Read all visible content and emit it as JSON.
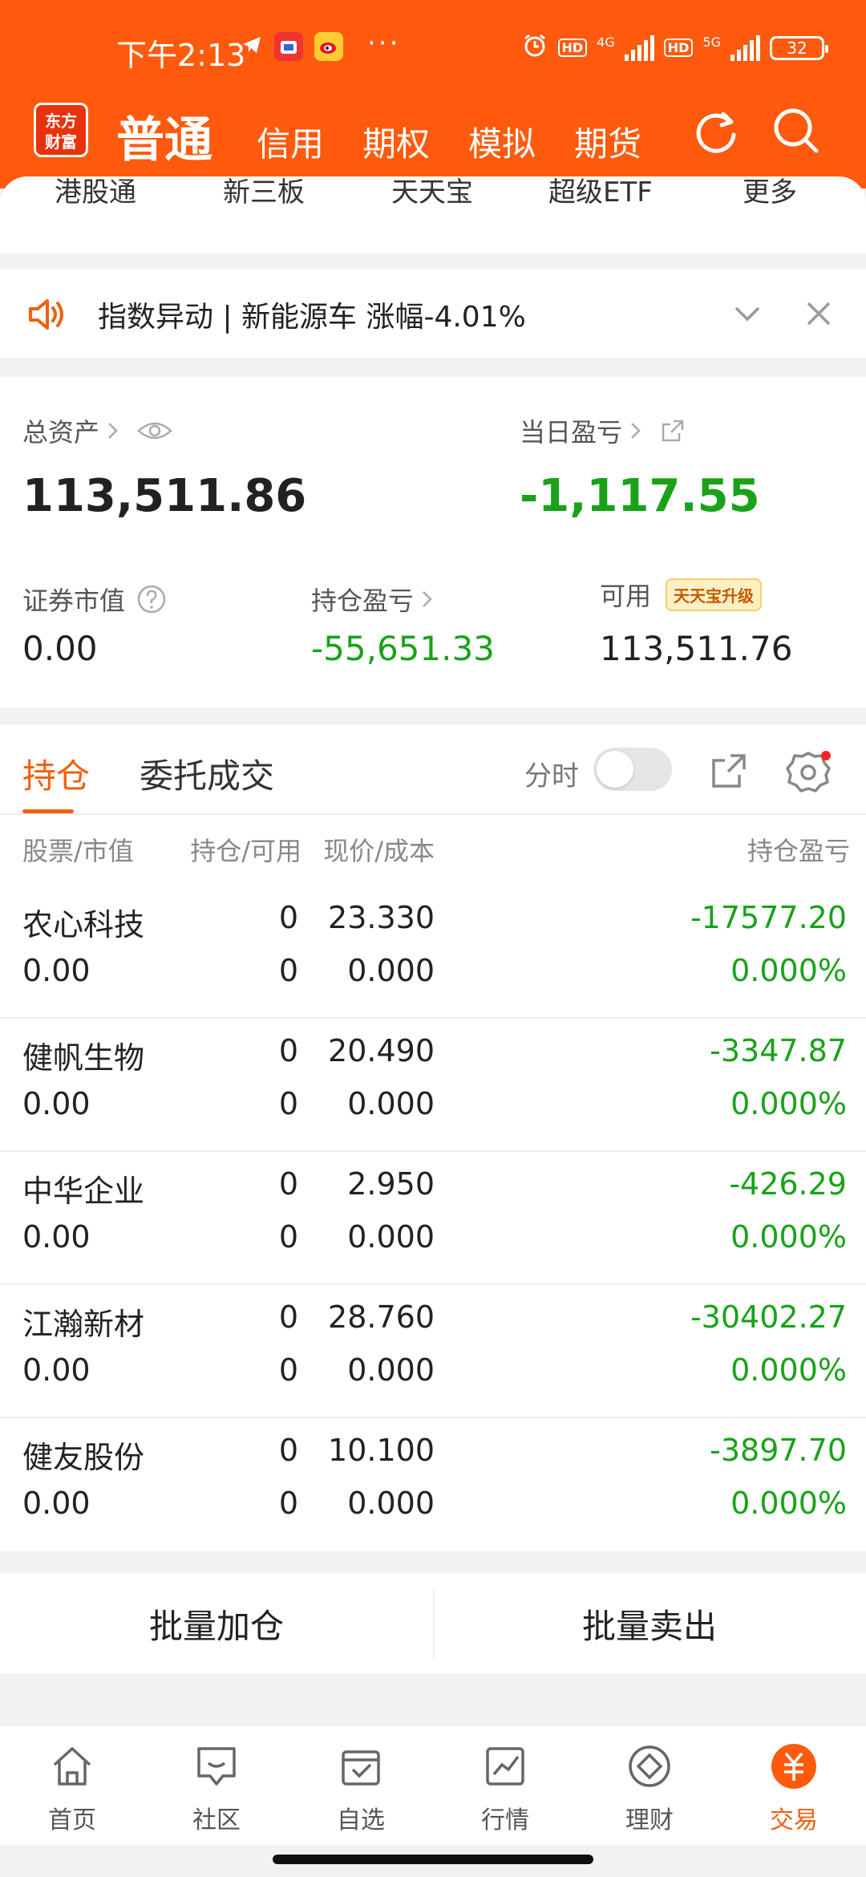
{
  "status_bar": {
    "time": "下午2:13",
    "dots": "···",
    "hd1": "HD",
    "net1": "4G",
    "hd2": "HD",
    "net2": "5G",
    "battery": "32"
  },
  "header": {
    "logo_line1": "东方",
    "logo_line2": "财富",
    "tabs": [
      "普通",
      "信用",
      "期权",
      "模拟",
      "期货"
    ]
  },
  "quick_links": [
    "港股通",
    "新三板",
    "天天宝",
    "超级ETF",
    "更多"
  ],
  "notice": {
    "text": "指数异动 | 新能源车 涨幅-4.01%"
  },
  "assets": {
    "total_label": "总资产",
    "total_value": "113,511.86",
    "daily_pl_label": "当日盈亏",
    "daily_pl_value": "-1,117.55",
    "market_value_label": "证券市值",
    "market_value": "0.00",
    "holding_pl_label": "持仓盈亏",
    "holding_pl_value": "-55,651.33",
    "available_label": "可用",
    "available_value": "113,511.76",
    "upgrade_badge": "天天宝升级"
  },
  "holdings": {
    "tab_active": "持仓",
    "tab_other": "委托成交",
    "fenshi_label": "分时",
    "fenshi_on": false,
    "columns": [
      "股票/市值",
      "持仓/可用",
      "现价/成本",
      "持仓盈亏"
    ],
    "rows": [
      {
        "name": "农心科技",
        "market_value": "0.00",
        "hold": "0",
        "avail": "0",
        "price": "23.330",
        "cost": "0.000",
        "pl": "-17577.20",
        "pl_pct": "0.000%"
      },
      {
        "name": "健帆生物",
        "market_value": "0.00",
        "hold": "0",
        "avail": "0",
        "price": "20.490",
        "cost": "0.000",
        "pl": "-3347.87",
        "pl_pct": "0.000%"
      },
      {
        "name": "中华企业",
        "market_value": "0.00",
        "hold": "0",
        "avail": "0",
        "price": "2.950",
        "cost": "0.000",
        "pl": "-426.29",
        "pl_pct": "0.000%"
      },
      {
        "name": "江瀚新材",
        "market_value": "0.00",
        "hold": "0",
        "avail": "0",
        "price": "28.760",
        "cost": "0.000",
        "pl": "-30402.27",
        "pl_pct": "0.000%"
      },
      {
        "name": "健友股份",
        "market_value": "0.00",
        "hold": "0",
        "avail": "0",
        "price": "10.100",
        "cost": "0.000",
        "pl": "-3897.70",
        "pl_pct": "0.000%"
      }
    ]
  },
  "batch": {
    "add": "批量加仓",
    "sell": "批量卖出"
  },
  "bottom_nav": [
    {
      "label": "首页",
      "icon": "home-icon"
    },
    {
      "label": "社区",
      "icon": "chat-icon"
    },
    {
      "label": "自选",
      "icon": "watchlist-icon"
    },
    {
      "label": "行情",
      "icon": "chart-icon"
    },
    {
      "label": "理财",
      "icon": "diamond-icon"
    },
    {
      "label": "交易",
      "icon": "yuan-icon"
    }
  ],
  "colors": {
    "brand_orange": "#ff5a0d",
    "active_orange": "#f0600f",
    "loss_green": "#19a219"
  }
}
